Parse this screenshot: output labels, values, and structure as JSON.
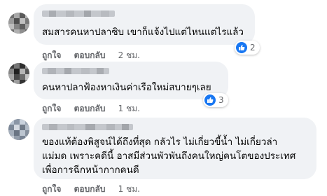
{
  "colors": {
    "bubble_bg": "#f0f2f5",
    "meta_text": "#65676b",
    "like_blue": "#1877f2"
  },
  "comments": [
    {
      "text_lines": [
        "สมสารคนหาปลาซิบ เขาก็แจ้งไปแต่ไหนแต่ไรแล้ว"
      ],
      "actions": {
        "like": "ถูกใจ",
        "reply": "ตอบกลับ",
        "time": "2 ชม."
      },
      "reaction": {
        "icon": "like-icon",
        "count": "2"
      }
    },
    {
      "text_lines": [
        "คนหาปลาฟ้องหาเงินค่าเรือใหม่สบายๆเลย"
      ],
      "actions": {
        "like": "ถูกใจ",
        "reply": "ตอบกลับ",
        "time": "1 ชม."
      },
      "reaction": {
        "icon": "like-icon",
        "count": "3"
      }
    },
    {
      "text_lines": [
        "ของแท้ต้องพิสูจน์ได้ถึงที่สุด กลัวไร ไม่เกี่ยวขี้น้ำ ไม่เกี่ยวล่า",
        "แม่มด เพราะคดีนี้ อาสมีส่วนพัวพันถึงคนใหญ่คนโตของประเทศ",
        "เพื่อการฉีกหน้ากากคนดี"
      ],
      "actions": {
        "like": "ถูกใจ",
        "reply": "ตอบกลับ",
        "time": "1 ชม."
      }
    }
  ]
}
